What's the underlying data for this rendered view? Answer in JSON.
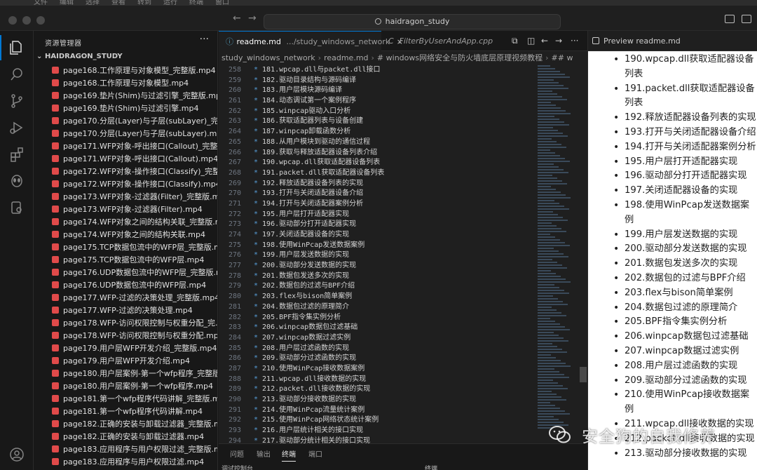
{
  "menubar": {
    "items": [
      "文件",
      "编辑",
      "选择",
      "查看",
      "转到",
      "运行",
      "终端",
      "窗口"
    ]
  },
  "titlebar": {
    "search_text": "haidragon_study"
  },
  "sidebar": {
    "title": "资源管理器",
    "folder": "HAIDRAGON_STUDY",
    "files": [
      "page168.工作原理与对象模型_完整版.mp4",
      "page168.工作原理与对象模型.mp4",
      "page169.垫片(Shim)与过滤引擎_完整版.mp4",
      "page169.垫片(Shim)与过滤引擎.mp4",
      "page170.分层(Layer)与子层(subLayer)_完整...",
      "page170.分层(Layer)与子层(subLayer).mp4",
      "page171.WFP对象-呼出接口(Callout)_完整版...",
      "page171.WFP对象-呼出接口(Callout).mp4",
      "page172.WFP对象-操作接口(Classify)_完整...",
      "page172.WFP对象-操作接口(Classify).mp4",
      "page173.WFP对象-过滤器(Filter)_完整版.mp4",
      "page173.WFP对象-过滤器(Filter).mp4",
      "page174.WFP对象之间的结构关联_完整版.m...",
      "page174.WFP对象之间的结构关联.mp4",
      "page175.TCP数据包流中的WFP层_完整版.m...",
      "page175.TCP数据包流中的WFP层.mp4",
      "page176.UDP数据包流中的WFP层_完整版.m...",
      "page176.UDP数据包流中的WFP层.mp4",
      "page177.WFP-过滤的决策处理_完整版.mp4",
      "page177.WFP-过滤的决策处理.mp4",
      "page178.WFP-访问权限控制与权重分配_完...",
      "page178.WFP-访问权限控制与权重分配.mp4",
      "page179.用户层WFP开发介绍_完整版.mp4",
      "page179.用户层WFP开发介绍.mp4",
      "page180.用户层案例-第一个wfp程序_完整版...",
      "page180.用户层案例-第一个wfp程序.mp4",
      "page181.第一个wfp程序代码讲解_完整版.mp4",
      "page181.第一个wfp程序代码讲解.mp4",
      "page182.正确的安装与卸载过滤器_完整版.m...",
      "page182.正确的安装与卸载过滤器.mp4",
      "page183.应用程序与用户权限过滤_完整版.m...",
      "page183.应用程序与用户权限过滤.mp4"
    ]
  },
  "editor": {
    "tabs": [
      {
        "label": "readme.md",
        "desc": ".../study_windows_network"
      },
      {
        "label": "FilterByUserAndApp.cpp",
        "desc": ""
      }
    ],
    "breadcrumb": [
      "study_windows_network",
      "readme.md",
      "# windows网络安全与防火墙底层原理视频教程",
      "## w"
    ],
    "lines": [
      {
        "n": "258",
        "t": "181.wpcap.dll与packet.dll接口"
      },
      {
        "n": "259",
        "t": "182.驱动目录结构与源码编译"
      },
      {
        "n": "260",
        "t": "183.用户层模块源码编译"
      },
      {
        "n": "261",
        "t": "184.动态调试第一个案例程序"
      },
      {
        "n": "262",
        "t": "185.winpcap驱动入口分析"
      },
      {
        "n": "263",
        "t": "186.获取适配器列表与设备创建"
      },
      {
        "n": "264",
        "t": "187.winpcap卸载函数分析"
      },
      {
        "n": "265",
        "t": "188.从用户模块到驱动的通信过程"
      },
      {
        "n": "266",
        "t": "189.获取与释放适配器设备列表介绍"
      },
      {
        "n": "267",
        "t": "190.wpcap.dll获取适配器设备列表"
      },
      {
        "n": "268",
        "t": "191.packet.dll获取适配器设备列表"
      },
      {
        "n": "269",
        "t": "192.释放适配器设备列表的实现"
      },
      {
        "n": "270",
        "t": "193.打开与关闭适配器设备介绍"
      },
      {
        "n": "271",
        "t": "194.打开与关闭适配器案例分析"
      },
      {
        "n": "272",
        "t": "195.用户层打开适配器实现"
      },
      {
        "n": "273",
        "t": "196.驱动部分打开适配器实现"
      },
      {
        "n": "274",
        "t": "197.关闭适配器设备的实现"
      },
      {
        "n": "275",
        "t": "198.使用WinPcap发送数据案例"
      },
      {
        "n": "276",
        "t": "199.用户层发送数据的实现"
      },
      {
        "n": "277",
        "t": "200.驱动部分发送数据的实现"
      },
      {
        "n": "278",
        "t": "201.数据包发送多次的实现"
      },
      {
        "n": "279",
        "t": "202.数据包的过滤与BPF介绍"
      },
      {
        "n": "280",
        "t": "203.flex与bison简单案例"
      },
      {
        "n": "281",
        "t": "204.数据包过滤的原理简介"
      },
      {
        "n": "282",
        "t": "205.BPF指令集实例分析"
      },
      {
        "n": "283",
        "t": "206.winpcap数据包过滤基础"
      },
      {
        "n": "284",
        "t": "207.winpcap数据过滤实例"
      },
      {
        "n": "285",
        "t": "208.用户层过滤函数的实现"
      },
      {
        "n": "286",
        "t": "209.驱动部分过滤函数的实现"
      },
      {
        "n": "287",
        "t": "210.使用WinPcap接收数据案例"
      },
      {
        "n": "288",
        "t": "211.wpcap.dll接收数据的实现"
      },
      {
        "n": "289",
        "t": "212.packet.dll接收数据的实现"
      },
      {
        "n": "290",
        "t": "213.驱动部分接收数据的实现"
      },
      {
        "n": "291",
        "t": "214.使用WinPcap流量统计案例"
      },
      {
        "n": "292",
        "t": "215.使用WinPcap网络状态统计案例"
      },
      {
        "n": "293",
        "t": "216.用户层统计相关的接口实现"
      },
      {
        "n": "294",
        "t": "217.驱动部分统计相关的接口实现"
      }
    ]
  },
  "panel": {
    "tabs": [
      "问题",
      "输出",
      "终端",
      "端口"
    ],
    "active": "终端",
    "debug_console": "调试控制台",
    "terminal_label": "终端"
  },
  "preview": {
    "tab_label": "Preview readme.md",
    "items": [
      "190.wpcap.dll获取适配器设备列表",
      "191.packet.dll获取适配器设备列表",
      "192.释放适配器设备列表的实现",
      "193.打开与关闭适配器设备介绍",
      "194.打开与关闭适配器案例分析",
      "195.用户层打开适配器实现",
      "196.驱动部分打开适配器实现",
      "197.关闭适配器设备的实现",
      "198.使用WinPcap发送数据案例",
      "199.用户层发送数据的实现",
      "200.驱动部分发送数据的实现",
      "201.数据包发送多次的实现",
      "202.数据包的过滤与BPF介绍",
      "203.flex与bison简单案例",
      "204.数据包过滤的原理简介",
      "205.BPF指令集实例分析",
      "206.winpcap数据包过滤基础",
      "207.winpcap数据过滤实例",
      "208.用户层过滤函数的实现",
      "209.驱动部分过滤函数的实现",
      "210.使用WinPcap接收数据案例",
      "211.wpcap.dll接收数据的实现",
      "212.packet.dll接收数据的实现",
      "213.驱动部分接收数据的实现"
    ]
  },
  "watermark": {
    "text": "安全狗的自我修养"
  },
  "colors": {
    "accent": "#0078d4",
    "bullet": "#569cd6",
    "file_icon": "#e04a4a"
  }
}
